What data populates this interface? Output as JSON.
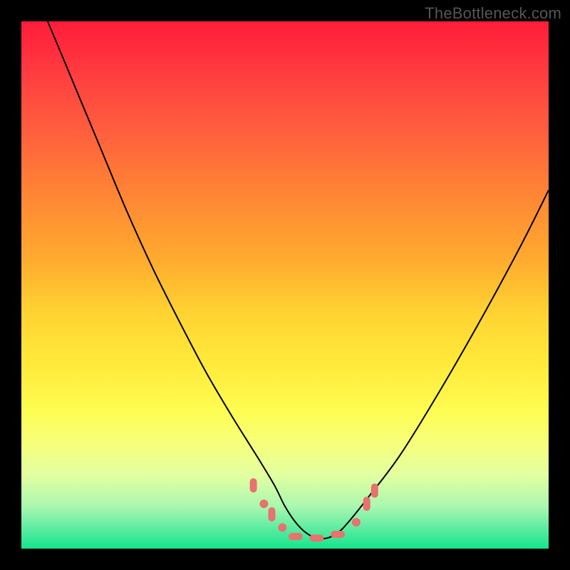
{
  "watermark": "TheBottleneck.com",
  "chart_data": {
    "type": "line",
    "title": "",
    "xlabel": "",
    "ylabel": "",
    "xlim": [
      0,
      100
    ],
    "ylim": [
      0,
      100
    ],
    "grid": false,
    "legend": false,
    "annotations": [],
    "background_gradient": {
      "stops": [
        {
          "offset": 0.0,
          "color": "#ff1d3a"
        },
        {
          "offset": 0.05,
          "color": "#ff2c3d"
        },
        {
          "offset": 0.12,
          "color": "#ff4440"
        },
        {
          "offset": 0.2,
          "color": "#ff5c3e"
        },
        {
          "offset": 0.28,
          "color": "#ff7638"
        },
        {
          "offset": 0.36,
          "color": "#ff8f33"
        },
        {
          "offset": 0.45,
          "color": "#ffaa2f"
        },
        {
          "offset": 0.55,
          "color": "#ffd232"
        },
        {
          "offset": 0.65,
          "color": "#ffea3a"
        },
        {
          "offset": 0.74,
          "color": "#fdfd52"
        },
        {
          "offset": 0.8,
          "color": "#f6ff7a"
        },
        {
          "offset": 0.86,
          "color": "#e3ffa0"
        },
        {
          "offset": 0.92,
          "color": "#aaf7b0"
        },
        {
          "offset": 0.97,
          "color": "#4dea9d"
        },
        {
          "offset": 1.0,
          "color": "#14e58c"
        }
      ]
    },
    "series": [
      {
        "name": "bottleneck-curve",
        "color": "#000000",
        "stroke_width": 2,
        "x": [
          0,
          5,
          10,
          15,
          20,
          25,
          30,
          35,
          40,
          45,
          48,
          50,
          52,
          54,
          56,
          58,
          60,
          62,
          66,
          72,
          80,
          88,
          95,
          100
        ],
        "values": [
          112,
          100,
          88,
          76,
          64,
          53,
          43,
          33.5,
          25,
          17,
          12,
          8,
          5,
          3,
          2,
          2,
          3,
          5,
          10,
          18,
          31,
          45,
          58,
          68
        ]
      }
    ],
    "markers": {
      "name": "highlight-region",
      "color": "#e7726f",
      "radius": 6,
      "capsule_half_height": 10,
      "capsule_half_width": 5,
      "points": [
        {
          "x": 44.0,
          "y": 12.0,
          "kind": "capsule"
        },
        {
          "x": 46.0,
          "y": 8.5,
          "kind": "dot"
        },
        {
          "x": 47.5,
          "y": 6.5,
          "kind": "capsule"
        },
        {
          "x": 49.5,
          "y": 4.0,
          "kind": "dot"
        },
        {
          "x": 52.0,
          "y": 2.3,
          "kind": "capsule-horizontal"
        },
        {
          "x": 56.0,
          "y": 2.0,
          "kind": "capsule-horizontal"
        },
        {
          "x": 60.0,
          "y": 2.7,
          "kind": "capsule-horizontal"
        },
        {
          "x": 63.5,
          "y": 5.0,
          "kind": "dot"
        },
        {
          "x": 65.5,
          "y": 8.5,
          "kind": "capsule"
        },
        {
          "x": 67.0,
          "y": 11.0,
          "kind": "capsule"
        }
      ]
    }
  }
}
